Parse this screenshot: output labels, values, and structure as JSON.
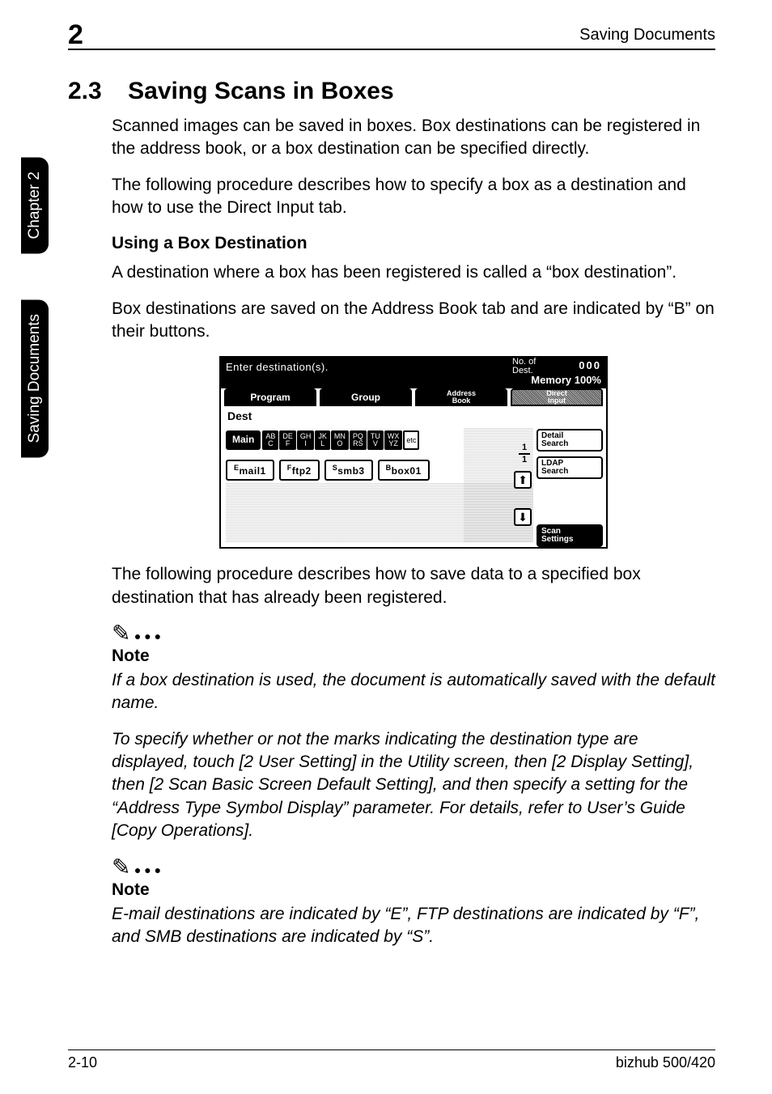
{
  "header": {
    "chapter_num": "2",
    "running_title": "Saving Documents"
  },
  "sidetabs": {
    "top": "Chapter 2",
    "bottom": "Saving Documents"
  },
  "section": {
    "num": "2.3",
    "title": "Saving Scans in Boxes"
  },
  "body": {
    "p1": "Scanned images can be saved in boxes. Box destinations can be registered in the address book, or a box destination can be specified directly.",
    "p2": "The following procedure describes how to specify a box as a destination and how to use the Direct Input tab.",
    "sub1": "Using a Box Destination",
    "p3": "A destination where a box has been registered is called a “box destination”.",
    "p4": "Box destinations are saved on the Address Book tab and are indicated by “B” on their buttons.",
    "p5": "The following procedure describes how to save data to a specified box destination that has already been registered.",
    "note1_label": "Note",
    "n1a": "If a box destination is used, the document is automatically saved with the default name.",
    "n1b": "To specify whether or not the marks indicating the destination type are displayed, touch [2 User Setting] in the Utility screen, then [2 Display Setting], then [2 Scan Basic Screen Default Setting], and then specify a setting for the “Address Type Symbol Display” parameter. For details, refer to User’s Guide [Copy Operations].",
    "note2_label": "Note",
    "n2a": "E-mail destinations are indicated by “E”, FTP destinations are indicated by “F”, and SMB destinations are indicated by “S”."
  },
  "lcd": {
    "topmsg": "Enter destination(s).",
    "dest_lbl_a": "No. of",
    "dest_lbl_b": "Dest.",
    "count": "000",
    "memory": "Memory 100%",
    "tabs": {
      "program": "Program",
      "group": "Group",
      "addrbook_a": "Address",
      "addrbook_b": "Book",
      "direct_a": "Direct",
      "direct_b": "Input"
    },
    "dest_label": "Dest",
    "main": "Main",
    "alpha": [
      [
        "AB",
        "C"
      ],
      [
        "DE",
        "F"
      ],
      [
        "GH",
        "I"
      ],
      [
        "JK",
        "L"
      ],
      [
        "MN",
        "O"
      ],
      [
        "PQ",
        "RS"
      ],
      [
        "TU",
        "V"
      ],
      [
        "WX",
        "YZ"
      ],
      [
        "etc",
        ""
      ]
    ],
    "buttons": {
      "mail1": "mail1",
      "ftp2": "ftp2",
      "smb3": "smb3",
      "box01": "box01"
    },
    "prefix": {
      "e": "E",
      "f": "F",
      "s": "S",
      "b": "B"
    },
    "frac_top": "1",
    "frac_bot": "1",
    "detail_a": "Detail",
    "detail_b": "Search",
    "ldap_a": "LDAP",
    "ldap_b": "Search",
    "scan_a": "Scan",
    "scan_b": "Settings",
    "arrow_up": "⬆",
    "arrow_down": "⬇"
  },
  "footer": {
    "left": "2-10",
    "right": "bizhub 500/420"
  }
}
